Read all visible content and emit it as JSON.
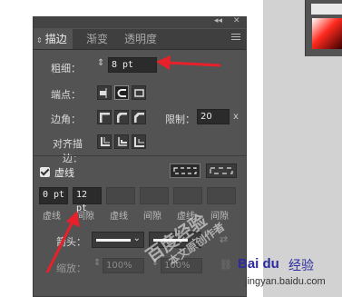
{
  "tabs": [
    {
      "label": "描边"
    },
    {
      "label": "渐变"
    },
    {
      "label": "透明度"
    }
  ],
  "weight": {
    "label": "粗细：",
    "value": "8 pt"
  },
  "cap": {
    "label": "端点："
  },
  "corner": {
    "label": "边角：",
    "limit_label": "限制：",
    "limit_value": "20",
    "limit_suffix": "x"
  },
  "align": {
    "label": "对齐描边："
  },
  "dashed": {
    "label": "虚线",
    "checked": true
  },
  "dash_fields": [
    "0 pt",
    "12 pt",
    "",
    "",
    "",
    ""
  ],
  "dash_labels": [
    "虚线",
    "间隙",
    "虚线",
    "间隙",
    "虚线",
    "间隙"
  ],
  "arrowheads": {
    "label": "箭头："
  },
  "scale": {
    "label": "缩放：",
    "value1": "100%",
    "value2": "100%"
  },
  "watermark": {
    "line1": "百度经验",
    "line2": "本文原创作者"
  },
  "brand": {
    "logo": "Bai du",
    "text": "经验",
    "url": "jingyan.baidu.com"
  },
  "colors": {
    "panel": "#535353",
    "annotation_arrow": "#e8202a",
    "field": "#2b2b2b"
  }
}
